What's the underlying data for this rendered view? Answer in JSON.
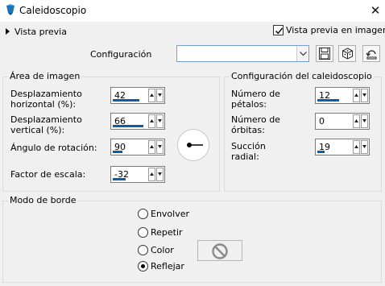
{
  "window": {
    "title": "Caleidoscopio",
    "close_glyph": "✕"
  },
  "preview": {
    "toggle_label": "Vista previa",
    "live_label": "Vista previa en imagen",
    "live_checked": true
  },
  "config": {
    "label": "Configuración",
    "selected_value": ""
  },
  "toolbar_icons": [
    "save-icon",
    "dice-icon",
    "reset-icon"
  ],
  "image_area": {
    "title": "Área de imagen",
    "fields": [
      {
        "label_lines": [
          "Desplazamiento",
          "horizontal (%):"
        ],
        "value": "42",
        "fill": 0.71
      },
      {
        "label_lines": [
          "Desplazamiento",
          "vertical (%):"
        ],
        "value": "66",
        "fill": 0.83
      },
      {
        "label_lines": [
          "Ángulo de rotación:"
        ],
        "value": "90",
        "fill": 0.25
      },
      {
        "label_lines": [
          "Factor de escala:"
        ],
        "value": "-32",
        "fill": 0.34
      }
    ]
  },
  "kaleido_config": {
    "title": "Configuración del caleidoscopio",
    "fields": [
      {
        "label_lines": [
          "Número de",
          "pétalos:"
        ],
        "value": "12",
        "fill": 0.58
      },
      {
        "label_lines": [
          "Número de",
          "órbitas:"
        ],
        "value": "0",
        "fill": 0.0
      },
      {
        "label_lines": [
          "Succión",
          "radial:"
        ],
        "value": "19",
        "fill": 0.19
      }
    ]
  },
  "border_mode": {
    "title": "Modo de borde",
    "options": [
      {
        "label": "Envolver",
        "selected": false
      },
      {
        "label": "Repetir",
        "selected": false
      },
      {
        "label": "Color",
        "selected": false
      },
      {
        "label": "Reflejar",
        "selected": true
      }
    ]
  },
  "colors": {
    "accent": "#0c5ca8",
    "icon_blue": "#1b75bb"
  }
}
